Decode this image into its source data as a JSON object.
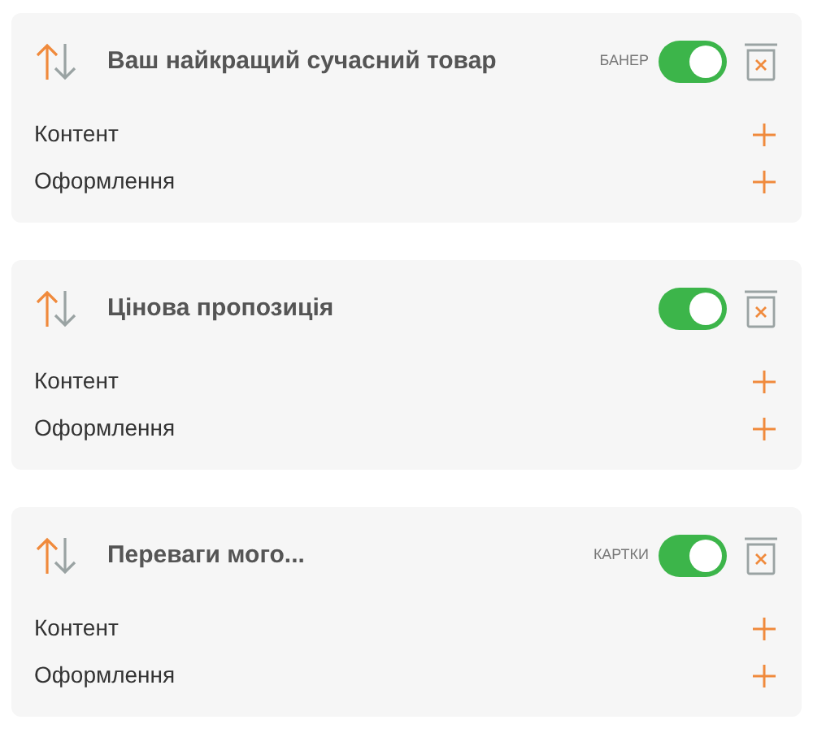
{
  "blocks": [
    {
      "title": "Ваш найкращий сучасний товар",
      "tag": "БАНЕР",
      "on": true,
      "sections": [
        "Контент",
        "Оформлення"
      ]
    },
    {
      "title": "Цінова пропозиція",
      "on": true,
      "sections": [
        "Контент",
        "Оформлення"
      ]
    },
    {
      "title": "Переваги мого...",
      "tag": "КАРТКИ",
      "on": true,
      "sections": [
        "Контент",
        "Оформлення"
      ]
    }
  ]
}
